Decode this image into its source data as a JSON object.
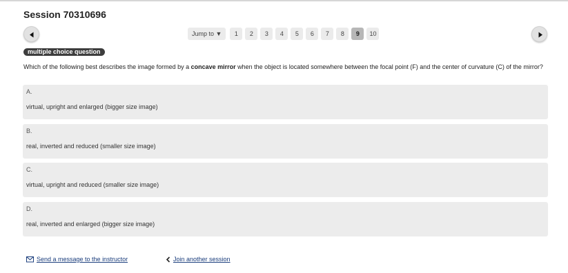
{
  "session": {
    "title": "Session 70310696"
  },
  "pager": {
    "jump_label": "Jump to ▼",
    "pages": [
      "1",
      "2",
      "3",
      "4",
      "5",
      "6",
      "7",
      "8",
      "9",
      "10"
    ],
    "current": "9"
  },
  "question": {
    "type_label": "multiple choice question",
    "text_before": "Which of the following best describes the image formed by a ",
    "text_bold": "concave mirror",
    "text_after": " when the object is located somewhere between the focal point (F) and the center of curvature (C) of the mirror?"
  },
  "options": [
    {
      "letter": "A.",
      "text": "virtual, upright and enlarged (bigger size image)"
    },
    {
      "letter": "B.",
      "text": "real, inverted and reduced (smaller size image)"
    },
    {
      "letter": "C.",
      "text": "virtual, upright and reduced (smaller size image)"
    },
    {
      "letter": "D.",
      "text": "real, inverted and enlarged (bigger size image)"
    }
  ],
  "footer": {
    "message_link": "Send a message to the instructor",
    "join_link": "Join another session"
  },
  "icons": {
    "prev": "triangle-left-icon",
    "next": "triangle-right-icon",
    "mail": "envelope-icon",
    "back": "chevron-left-icon"
  }
}
